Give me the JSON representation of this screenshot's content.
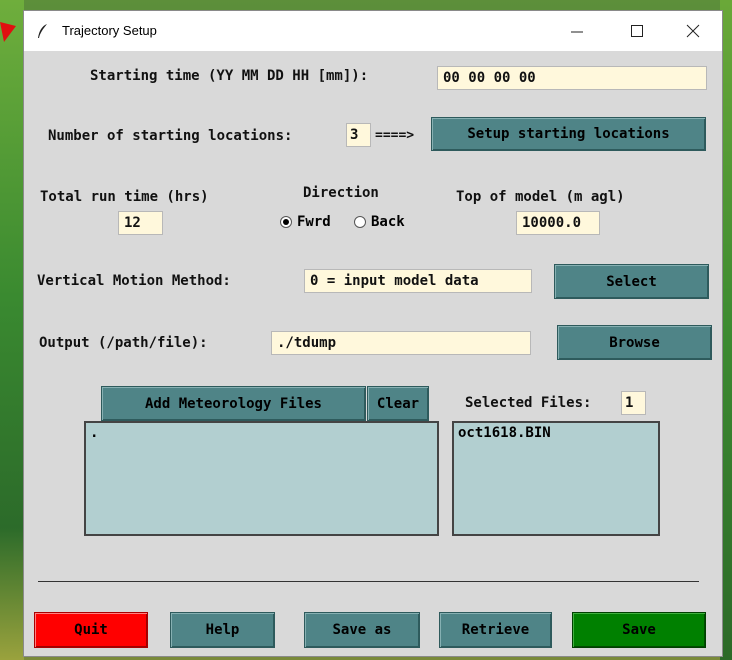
{
  "window": {
    "title": "Trajectory Setup"
  },
  "start": {
    "label": "Starting time (YY MM DD HH [mm]):",
    "value": "00 00 00 00"
  },
  "locations": {
    "label": "Number of starting locations:",
    "value": "3",
    "arrow": "====>",
    "button": "Setup starting locations"
  },
  "runtime": {
    "label": "Total run time (hrs)",
    "value": "12"
  },
  "direction": {
    "label": "Direction",
    "fwrd": "Fwrd",
    "back": "Back",
    "selected": "Fwrd"
  },
  "top": {
    "label": "Top of model (m agl)",
    "value": "10000.0"
  },
  "vertical": {
    "label": "Vertical Motion Method:",
    "value": "0 = input model data",
    "button": "Select"
  },
  "output": {
    "label": "Output (/path/file):",
    "value": "./tdump",
    "button": "Browse"
  },
  "met": {
    "add_button": "Add Meteorology Files",
    "clear_button": "Clear",
    "list_item": "."
  },
  "selected": {
    "label": "Selected Files:",
    "count": "1",
    "file": "oct1618.BIN"
  },
  "footer": {
    "quit": "Quit",
    "help": "Help",
    "saveas": "Save as",
    "retrieve": "Retrieve",
    "save": "Save"
  },
  "colors": {
    "accent": "#4f8487",
    "quit": "#ff0000",
    "save": "#008000",
    "entry": "#fff8dc",
    "listbox": "#b2cfd0"
  }
}
